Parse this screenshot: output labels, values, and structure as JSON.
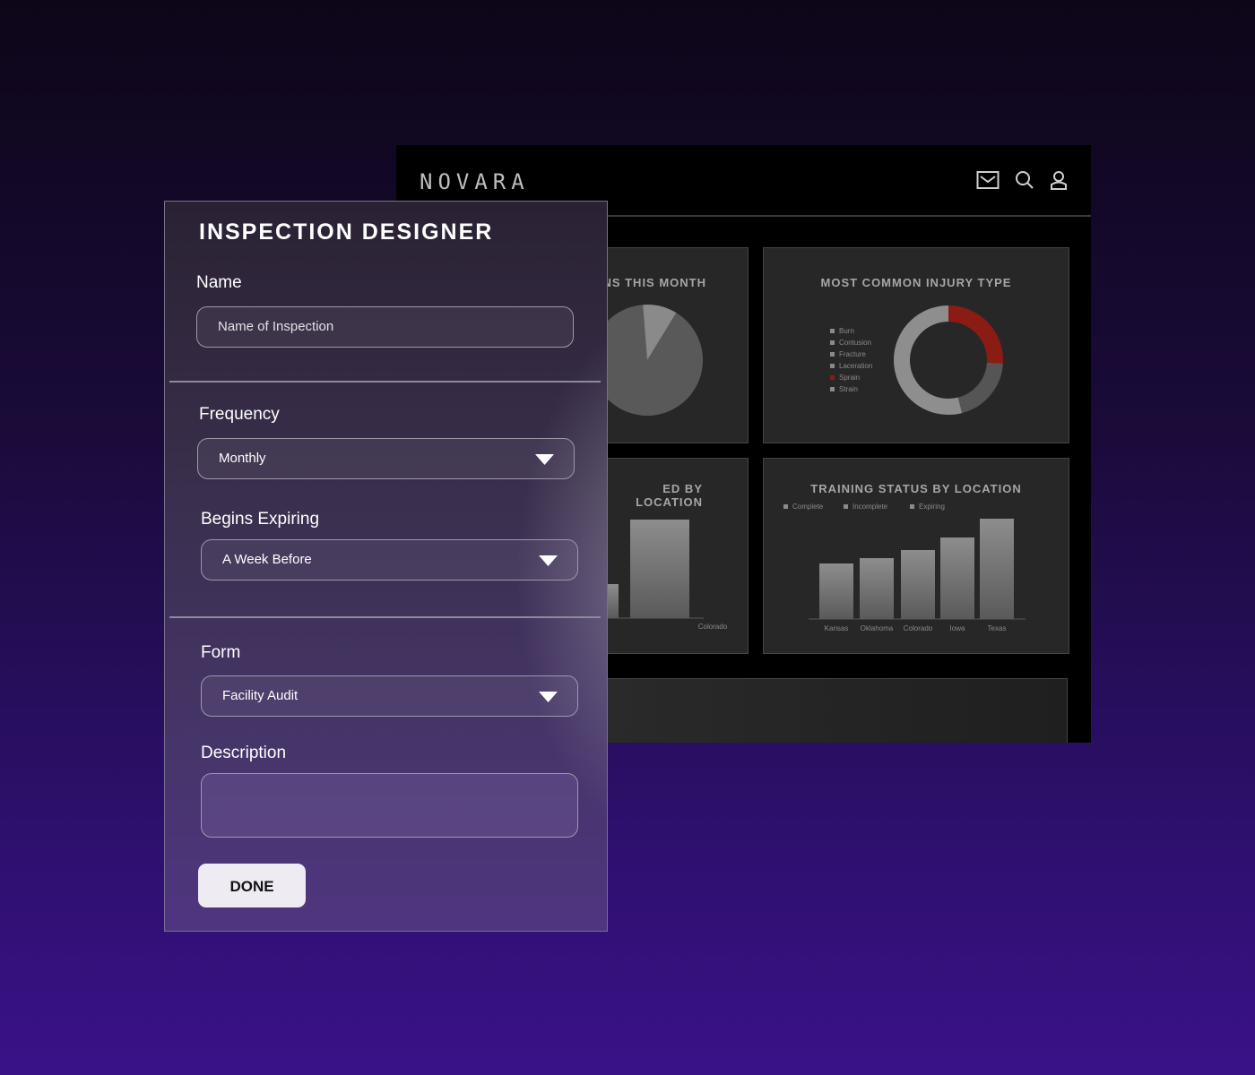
{
  "dashboard": {
    "brand": "NOVARA",
    "icons": [
      "mail-icon",
      "search-icon",
      "user-icon"
    ],
    "cards": {
      "inspections_title": "NS THIS MONTH",
      "injury_title": "MOST COMMON INJURY TYPE",
      "location_title": "ED BY LOCATION",
      "training_title": "TRAINING STATUS BY LOCATION"
    },
    "location_partial": {
      "category": "Colorado"
    }
  },
  "chart_data": [
    {
      "type": "pie",
      "title": "NS THIS MONTH",
      "note": "partially hidden behind panel",
      "slices": [
        {
          "label": "",
          "value": 0.9
        },
        {
          "label": "",
          "value": 0.1
        }
      ]
    },
    {
      "type": "pie",
      "title": "MOST COMMON INJURY TYPE",
      "legend": [
        "Burn",
        "Contusion",
        "Fracture",
        "Laceration",
        "Sprain",
        "Strain"
      ],
      "slices": [
        {
          "label": "Sprain",
          "value": 0.26,
          "color": "#8b1c14"
        },
        {
          "label": "Burn",
          "value": 0.2,
          "color": "#555555"
        },
        {
          "label": "Strain",
          "value": 0.54,
          "color": "#8e8e8e"
        }
      ]
    },
    {
      "type": "bar",
      "title": "TRAINING STATUS BY LOCATION",
      "legend": [
        "Complete",
        "Incomplete",
        "Expiring"
      ],
      "categories": [
        "Kansas",
        "Oklahoma",
        "Colorado",
        "Iowa",
        "Texas"
      ],
      "values": [
        62,
        68,
        77,
        91,
        112
      ]
    },
    {
      "type": "bar",
      "title": "ED BY LOCATION",
      "categories": [
        "",
        "Colorado"
      ],
      "values": [
        38,
        110
      ]
    }
  ],
  "designer": {
    "title": "INSPECTION DESIGNER",
    "name_label": "Name",
    "name_placeholder": "Name of Inspection",
    "frequency_label": "Frequency",
    "frequency_value": "Monthly",
    "begins_label": "Begins Expiring",
    "begins_value": "A Week Before",
    "form_label": "Form",
    "form_value": "Facility Audit",
    "description_label": "Description",
    "description_value": "",
    "done_label": "DONE"
  }
}
